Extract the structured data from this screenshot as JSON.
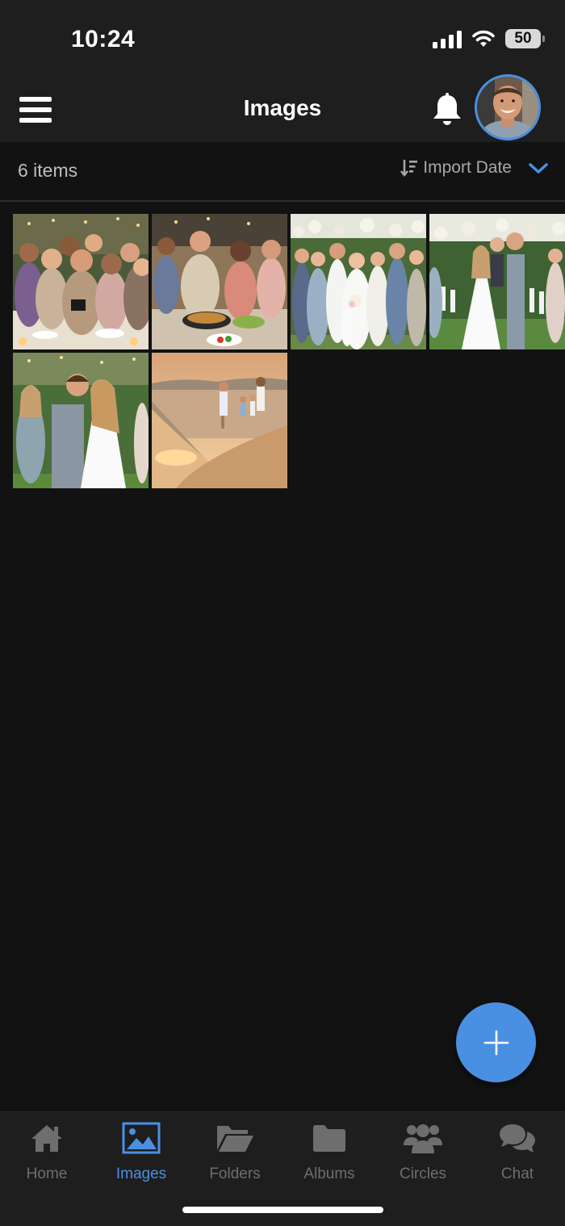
{
  "status_bar": {
    "time": "10:24",
    "battery": "50"
  },
  "header": {
    "title": "Images"
  },
  "toolbar": {
    "item_count": "6 items",
    "sort_label": "Import Date"
  },
  "photos": [
    {
      "icon": "group-selfie-photo"
    },
    {
      "icon": "cooking-party-photo"
    },
    {
      "icon": "wedding-group-photo"
    },
    {
      "icon": "wedding-ceremony-photo"
    },
    {
      "icon": "wedding-dance-photo"
    },
    {
      "icon": "beach-sunset-photo"
    }
  ],
  "tabs": [
    {
      "label": "Home",
      "icon": "home-icon",
      "active": false
    },
    {
      "label": "Images",
      "icon": "image-icon",
      "active": true
    },
    {
      "label": "Folders",
      "icon": "folder-open-icon",
      "active": false
    },
    {
      "label": "Albums",
      "icon": "folder-icon",
      "active": false
    },
    {
      "label": "Circles",
      "icon": "users-icon",
      "active": false
    },
    {
      "label": "Chat",
      "icon": "chat-icon",
      "active": false
    }
  ],
  "colors": {
    "accent": "#4a90e2",
    "background": "#121212",
    "header": "#1e1e1e",
    "tab_inactive": "#6e6e6e"
  }
}
